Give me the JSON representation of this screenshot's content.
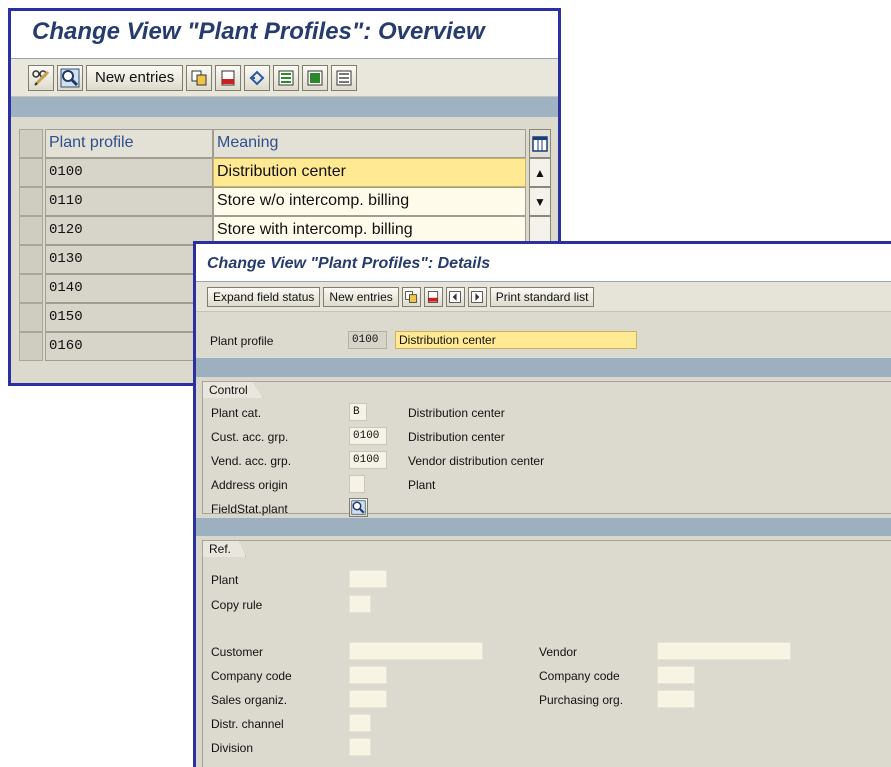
{
  "overview": {
    "title": "Change View \"Plant Profiles\": Overview",
    "toolbar": {
      "new_entries_label": "New entries"
    },
    "columns": {
      "plant_profile": "Plant profile",
      "meaning": "Meaning"
    },
    "rows": [
      {
        "profile": "0100",
        "meaning": "Distribution center"
      },
      {
        "profile": "0110",
        "meaning": "Store w/o intercomp. billing"
      },
      {
        "profile": "0120",
        "meaning": "Store with intercomp. billing"
      },
      {
        "profile": "0130",
        "meaning": ""
      },
      {
        "profile": "0140",
        "meaning": ""
      },
      {
        "profile": "0150",
        "meaning": ""
      },
      {
        "profile": "0160",
        "meaning": ""
      }
    ]
  },
  "details": {
    "title": "Change View \"Plant Profiles\": Details",
    "toolbar": {
      "expand_field_status": "Expand field status",
      "new_entries": "New entries",
      "print_standard_list": "Print standard list"
    },
    "header": {
      "plant_profile_label": "Plant profile",
      "plant_profile_value": "0100",
      "plant_profile_text": "Distribution center"
    },
    "control": {
      "group_title": "Control",
      "plant_cat_label": "Plant cat.",
      "plant_cat_value": "B",
      "plant_cat_text": "Distribution center",
      "cust_acc_grp_label": "Cust. acc. grp.",
      "cust_acc_grp_value": "0100",
      "cust_acc_grp_text": "Distribution center",
      "vend_acc_grp_label": "Vend. acc. grp.",
      "vend_acc_grp_value": "0100",
      "vend_acc_grp_text": "Vendor distribution center",
      "address_origin_label": "Address origin",
      "address_origin_text": "Plant",
      "fieldstat_plant_label": "FieldStat.plant"
    },
    "ref": {
      "group_title": "Ref.",
      "plant_label": "Plant",
      "copy_rule_label": "Copy rule",
      "customer_label": "Customer",
      "company_code_label": "Company code",
      "sales_organiz_label": "Sales organiz.",
      "distr_channel_label": "Distr. channel",
      "division_label": "Division",
      "vendor_label": "Vendor",
      "vendor_company_code_label": "Company code",
      "purchasing_org_label": "Purchasing org."
    }
  },
  "colors": {
    "window_border": "#2c2f9e",
    "title_text": "#263b6e",
    "selected_field": "#ffe993",
    "stripe": "#9cb0bf"
  }
}
